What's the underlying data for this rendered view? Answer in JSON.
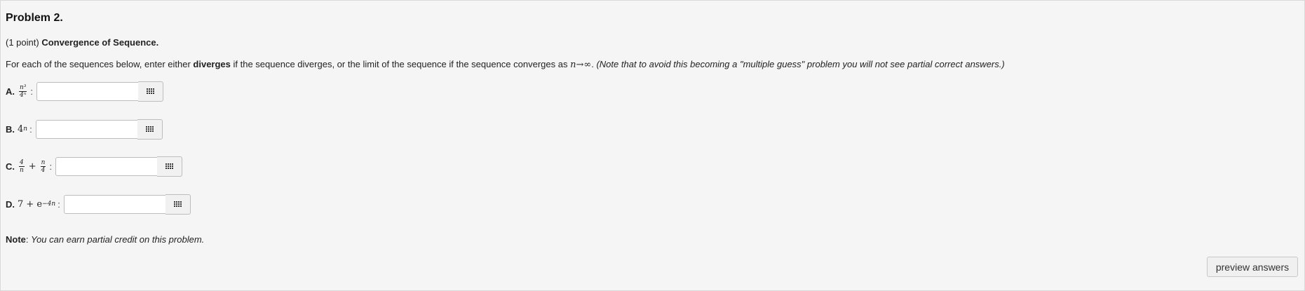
{
  "problem": {
    "title": "Problem 2.",
    "points": "(1 point)",
    "heading": "Convergence of Sequence.",
    "instr_before": "For each of the sequences below, enter either",
    "instr_keyword": "diverges",
    "instr_after": "if the sequence diverges, or the limit of the sequence if the sequence converges as",
    "instr_math_n": "n",
    "instr_math_arrow": "→",
    "instr_math_inf": "∞",
    "instr_note": "(Note that to avoid this becoming a \"multiple guess\" problem you will not see partial correct answers.)"
  },
  "rows": [
    {
      "label": "A.",
      "num": "n³",
      "den": "4ⁿ",
      "value": ""
    },
    {
      "label": "B.",
      "base": "4",
      "exp": "n",
      "value": ""
    },
    {
      "label": "C.",
      "f1_num": "4",
      "f1_den": "n",
      "plus": "+",
      "f2_num": "n",
      "f2_den": "4",
      "value": ""
    },
    {
      "label": "D.",
      "lead": "7 + e",
      "exp": "−4n",
      "value": ""
    }
  ],
  "colon": ":",
  "note": {
    "label": "Note",
    "text": "You can earn partial credit on this problem."
  },
  "preview_button": "preview answers",
  "icons": {
    "palette": "grid-icon"
  }
}
